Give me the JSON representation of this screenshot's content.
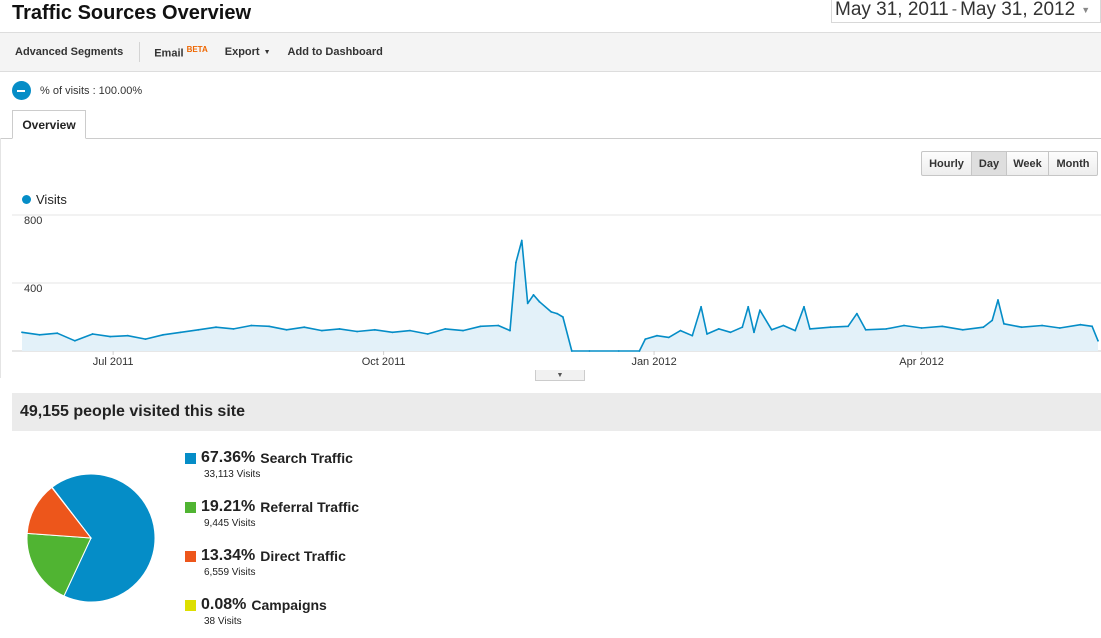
{
  "page": {
    "title": "Traffic Sources Overview",
    "date_range": {
      "start": "May 31, 2011",
      "separator": "-",
      "end": "May 31, 2012",
      "dropdown_icon": "triangle-down-icon"
    }
  },
  "toolbar": {
    "advanced_segments": "Advanced Segments",
    "email": "Email",
    "email_badge": "BETA",
    "export": "Export",
    "add_to_dashboard": "Add to Dashboard"
  },
  "segment": {
    "icon": "pie-segment-icon",
    "label": "% of visits : 100.00%"
  },
  "tabs": [
    {
      "label": "Overview",
      "active": true
    }
  ],
  "granularity": {
    "buttons": [
      "Hourly",
      "Day",
      "Week",
      "Month"
    ],
    "selected": "Day"
  },
  "chart_data": {
    "type": "area",
    "x_start": "2011-05-31",
    "x_end": "2012-05-31",
    "series": [
      {
        "name": "Visits",
        "color": "#058dc7",
        "points": [
          [
            "2011-05-31",
            110
          ],
          [
            "2011-06-06",
            95
          ],
          [
            "2011-06-12",
            105
          ],
          [
            "2011-06-18",
            60
          ],
          [
            "2011-06-24",
            100
          ],
          [
            "2011-06-30",
            85
          ],
          [
            "2011-07-06",
            90
          ],
          [
            "2011-07-12",
            70
          ],
          [
            "2011-07-18",
            95
          ],
          [
            "2011-07-24",
            110
          ],
          [
            "2011-07-30",
            125
          ],
          [
            "2011-08-05",
            140
          ],
          [
            "2011-08-11",
            130
          ],
          [
            "2011-08-17",
            150
          ],
          [
            "2011-08-23",
            145
          ],
          [
            "2011-08-29",
            125
          ],
          [
            "2011-09-04",
            140
          ],
          [
            "2011-09-10",
            120
          ],
          [
            "2011-09-16",
            130
          ],
          [
            "2011-09-22",
            115
          ],
          [
            "2011-09-28",
            125
          ],
          [
            "2011-10-04",
            110
          ],
          [
            "2011-10-10",
            120
          ],
          [
            "2011-10-16",
            100
          ],
          [
            "2011-10-22",
            130
          ],
          [
            "2011-10-28",
            120
          ],
          [
            "2011-11-03",
            145
          ],
          [
            "2011-11-09",
            150
          ],
          [
            "2011-11-13",
            120
          ],
          [
            "2011-11-15",
            520
          ],
          [
            "2011-11-17",
            650
          ],
          [
            "2011-11-19",
            280
          ],
          [
            "2011-11-21",
            330
          ],
          [
            "2011-11-23",
            290
          ],
          [
            "2011-11-27",
            230
          ],
          [
            "2011-11-29",
            220
          ],
          [
            "2011-12-01",
            200
          ],
          [
            "2011-12-04",
            0
          ],
          [
            "2011-12-10",
            0
          ],
          [
            "2011-12-20",
            0
          ],
          [
            "2011-12-27",
            0
          ],
          [
            "2011-12-29",
            70
          ],
          [
            "2012-01-02",
            90
          ],
          [
            "2012-01-06",
            80
          ],
          [
            "2012-01-10",
            120
          ],
          [
            "2012-01-14",
            90
          ],
          [
            "2012-01-17",
            260
          ],
          [
            "2012-01-19",
            100
          ],
          [
            "2012-01-23",
            130
          ],
          [
            "2012-01-27",
            110
          ],
          [
            "2012-01-31",
            140
          ],
          [
            "2012-02-02",
            260
          ],
          [
            "2012-02-04",
            110
          ],
          [
            "2012-02-06",
            240
          ],
          [
            "2012-02-10",
            125
          ],
          [
            "2012-02-14",
            150
          ],
          [
            "2012-02-18",
            120
          ],
          [
            "2012-02-21",
            260
          ],
          [
            "2012-02-23",
            130
          ],
          [
            "2012-03-01",
            140
          ],
          [
            "2012-03-07",
            145
          ],
          [
            "2012-03-10",
            220
          ],
          [
            "2012-03-13",
            125
          ],
          [
            "2012-03-20",
            130
          ],
          [
            "2012-03-26",
            150
          ],
          [
            "2012-04-01",
            135
          ],
          [
            "2012-04-08",
            145
          ],
          [
            "2012-04-15",
            125
          ],
          [
            "2012-04-22",
            140
          ],
          [
            "2012-04-25",
            180
          ],
          [
            "2012-04-27",
            300
          ],
          [
            "2012-04-29",
            160
          ],
          [
            "2012-05-05",
            140
          ],
          [
            "2012-05-12",
            150
          ],
          [
            "2012-05-18",
            135
          ],
          [
            "2012-05-25",
            155
          ],
          [
            "2012-05-29",
            145
          ],
          [
            "2012-05-31",
            60
          ]
        ]
      }
    ],
    "ylim": [
      0,
      800
    ],
    "y_ticks": [
      {
        "value": 800,
        "label": "800"
      },
      {
        "value": 400,
        "label": "400"
      }
    ],
    "x_ticks": [
      {
        "date": "2011-07-01",
        "label": "Jul 2011"
      },
      {
        "date": "2011-10-01",
        "label": "Oct 2011"
      },
      {
        "date": "2012-01-01",
        "label": "Jan 2012"
      },
      {
        "date": "2012-04-01",
        "label": "Apr 2012"
      }
    ],
    "grid": true
  },
  "summary": {
    "headline": "49,155 people visited this site"
  },
  "breakdown": {
    "pie_type": "pie",
    "sources": [
      {
        "percent": "67.36%",
        "value": 67.36,
        "label": "Search Traffic",
        "visits": "33,113 Visits",
        "color": "#058dc7"
      },
      {
        "percent": "19.21%",
        "value": 19.21,
        "label": "Referral Traffic",
        "visits": "9,445 Visits",
        "color": "#50b432"
      },
      {
        "percent": "13.34%",
        "value": 13.34,
        "label": "Direct Traffic",
        "visits": "6,559 Visits",
        "color": "#ed561b"
      },
      {
        "percent": "0.08%",
        "value": 0.08,
        "label": "Campaigns",
        "visits": "38 Visits",
        "color": "#dddf00"
      }
    ]
  },
  "collapse_icon": "triangle-down-icon"
}
